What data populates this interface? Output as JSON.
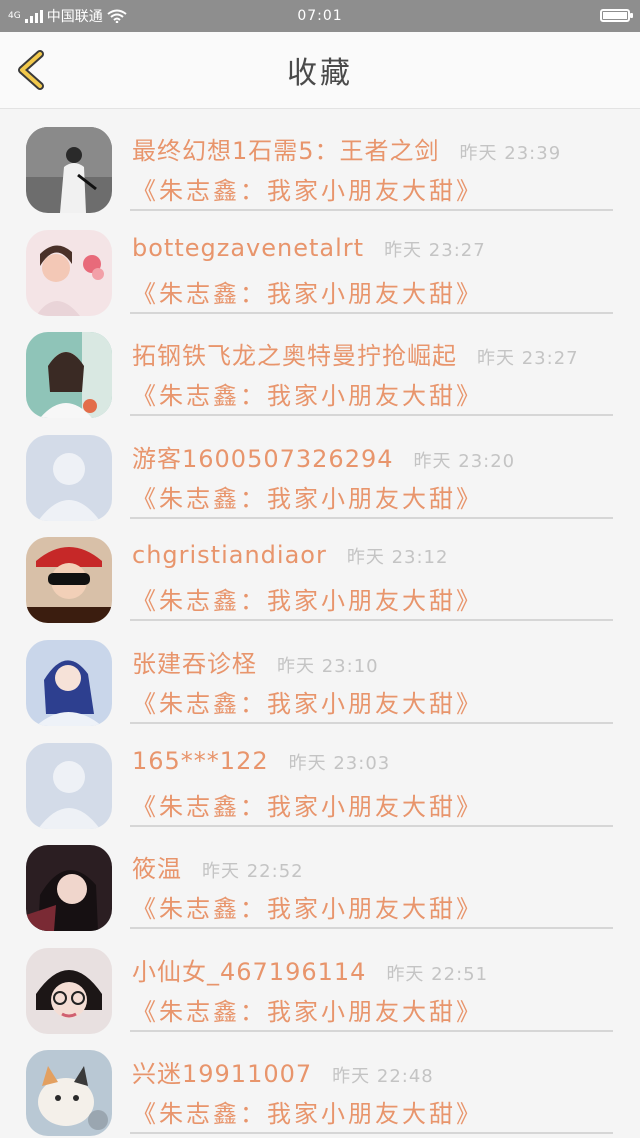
{
  "status_bar": {
    "network": "4G",
    "carrier": "中国联通",
    "time": "07:01"
  },
  "header": {
    "title": "收藏",
    "back_icon": "chevron-left-icon",
    "accent_color": "#f2c94c"
  },
  "items": [
    {
      "name": "最终幻想1石需5：王者之剑",
      "time": "昨天 23:39",
      "message": "《朱志鑫：我家小朋友大甜》",
      "avatar": "person-photo-bw"
    },
    {
      "name": "bottegzavenetalrt",
      "time": "昨天 23:27",
      "message": "《朱志鑫：我家小朋友大甜》",
      "avatar": "girl-photo-flowers"
    },
    {
      "name": "拓钢铁飞龙之奥特曼拧抢崛起",
      "time": "昨天 23:27",
      "message": "《朱志鑫：我家小朋友大甜》",
      "avatar": "girl-photo-braids"
    },
    {
      "name": "游客1600507326294",
      "time": "昨天 23:20",
      "message": "《朱志鑫：我家小朋友大甜》",
      "avatar": "default-user-silhouette"
    },
    {
      "name": "chgristiandiaor",
      "time": "昨天 23:12",
      "message": "《朱志鑫：我家小朋友大甜》",
      "avatar": "person-photo-red-cap"
    },
    {
      "name": "张建吞诊柽",
      "time": "昨天 23:10",
      "message": "《朱志鑫：我家小朋友大甜》",
      "avatar": "girl-photo-blue-hair"
    },
    {
      "name": "165***122",
      "time": "昨天 23:03",
      "message": "《朱志鑫：我家小朋友大甜》",
      "avatar": "default-user-silhouette"
    },
    {
      "name": "筱温",
      "time": "昨天 22:52",
      "message": "《朱志鑫：我家小朋友大甜》",
      "avatar": "girl-photo-dark"
    },
    {
      "name": "小仙女_467196114",
      "time": "昨天 22:51",
      "message": "《朱志鑫：我家小朋友大甜》",
      "avatar": "girl-photo-glasses"
    },
    {
      "name": "兴迷19911007",
      "time": "昨天 22:48",
      "message": "《朱志鑫：我家小朋友大甜》",
      "avatar": "cat-photo"
    }
  ]
}
